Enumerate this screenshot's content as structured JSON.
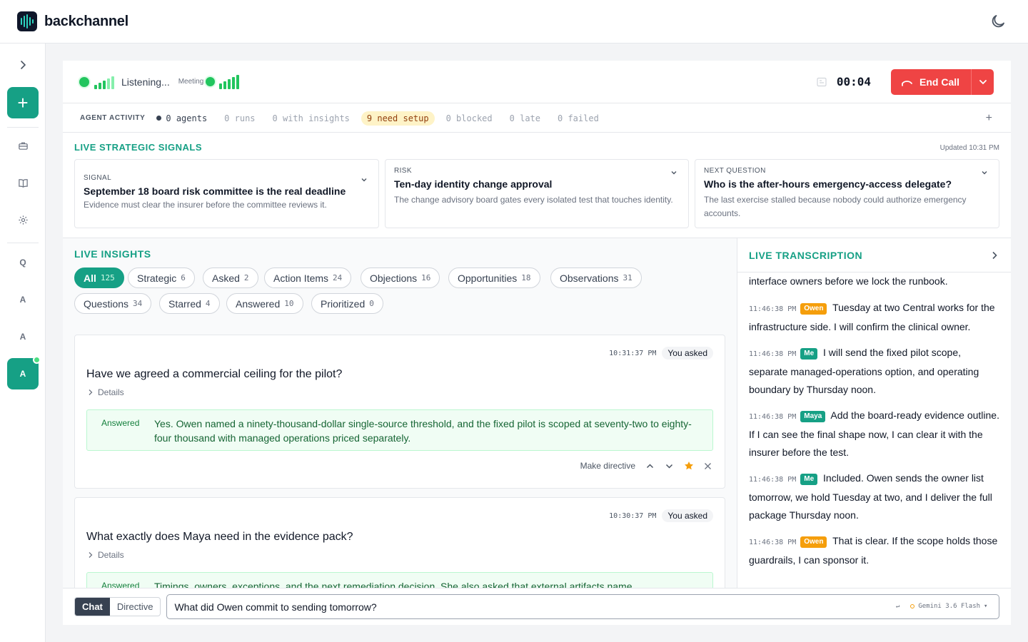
{
  "app": {
    "brand": "backchannel"
  },
  "rail": {
    "items": [
      "Q",
      "A",
      "A",
      "A"
    ]
  },
  "call": {
    "status": "Listening...",
    "source_label": "Meeting",
    "timer": "00:04",
    "end_call_label": "End Call"
  },
  "agent_activity": {
    "title": "AGENT ACTIVITY",
    "agents": "0 agents",
    "runs": "0 runs",
    "with_insights": "0 with insights",
    "need_setup": "9 need setup",
    "blocked": "0 blocked",
    "late": "0 late",
    "failed": "0 failed"
  },
  "signals": {
    "title": "LIVE STRATEGIC SIGNALS",
    "updated": "Updated 10:31 PM",
    "cards": [
      {
        "kind": "SIGNAL",
        "headline": "September 18 board risk committee is the real deadline",
        "body": "Evidence must clear the insurer before the committee reviews it."
      },
      {
        "kind": "RISK",
        "headline": "Ten-day identity change approval",
        "body": "The change advisory board gates every isolated test that touches identity."
      },
      {
        "kind": "NEXT QUESTION",
        "headline": "Who is the after-hours emergency-access delegate?",
        "body": "The last exercise stalled because nobody could authorize emergency accounts."
      }
    ]
  },
  "insights": {
    "title": "LIVE INSIGHTS",
    "filters": [
      {
        "label": "All",
        "count": "125"
      },
      {
        "label": "Strategic",
        "count": "6"
      },
      {
        "label": "Asked",
        "count": "2"
      },
      {
        "label": "Action Items",
        "count": "24"
      },
      {
        "label": "Objections",
        "count": "16"
      },
      {
        "label": "Opportunities",
        "count": "18"
      },
      {
        "label": "Observations",
        "count": "31"
      },
      {
        "label": "Questions",
        "count": "34"
      },
      {
        "label": "Starred",
        "count": "4"
      },
      {
        "label": "Answered",
        "count": "10"
      },
      {
        "label": "Prioritized",
        "count": "0"
      }
    ],
    "cards": [
      {
        "time": "10:31:37 PM",
        "badge": "You asked",
        "question": "Have we agreed a commercial ceiling for the pilot?",
        "details": "Details",
        "answer_label": "Answered",
        "answer": "Yes. Owen named a ninety-thousand-dollar single-source threshold, and the fixed pilot is scoped at seventy-two to eighty-four thousand with managed operations priced separately.",
        "make_directive": "Make directive"
      },
      {
        "time": "10:30:37 PM",
        "badge": "You asked",
        "question": "What exactly does Maya need in the evidence pack?",
        "details": "Details",
        "answer_label": "Answered",
        "answer": "Timings, owners, exceptions, and the next remediation decision. She also asked that external artifacts name"
      }
    ]
  },
  "transcript": {
    "title": "LIVE TRANSCRIPTION",
    "lead": "interface owners before we lock the runbook.",
    "entries": [
      {
        "time": "11:46:38 PM",
        "speaker": "Owen",
        "text": "Tuesday at two Central works for the infrastructure side. I will confirm the clinical owner."
      },
      {
        "time": "11:46:38 PM",
        "speaker": "Me",
        "text": "I will send the fixed pilot scope, separate managed-operations option, and operating boundary by Thursday noon."
      },
      {
        "time": "11:46:38 PM",
        "speaker": "Maya",
        "text": "Add the board-ready evidence outline. If I can see the final shape now, I can clear it with the insurer before the test."
      },
      {
        "time": "11:46:38 PM",
        "speaker": "Me",
        "text": "Included. Owen sends the owner list tomorrow, we hold Tuesday at two, and I deliver the full package Thursday noon."
      },
      {
        "time": "11:46:38 PM",
        "speaker": "Owen",
        "text": "That is clear. If the scope holds those guardrails, I can sponsor it."
      }
    ]
  },
  "composer": {
    "mode_chat": "Chat",
    "mode_directive": "Directive",
    "value": "What did Owen commit to sending tomorrow?",
    "enter_hint": "↵",
    "model": "Gemini 3.6 Flash"
  },
  "colors": {
    "accent": "#16a085",
    "danger": "#ef4444",
    "live": "#22c55e"
  }
}
